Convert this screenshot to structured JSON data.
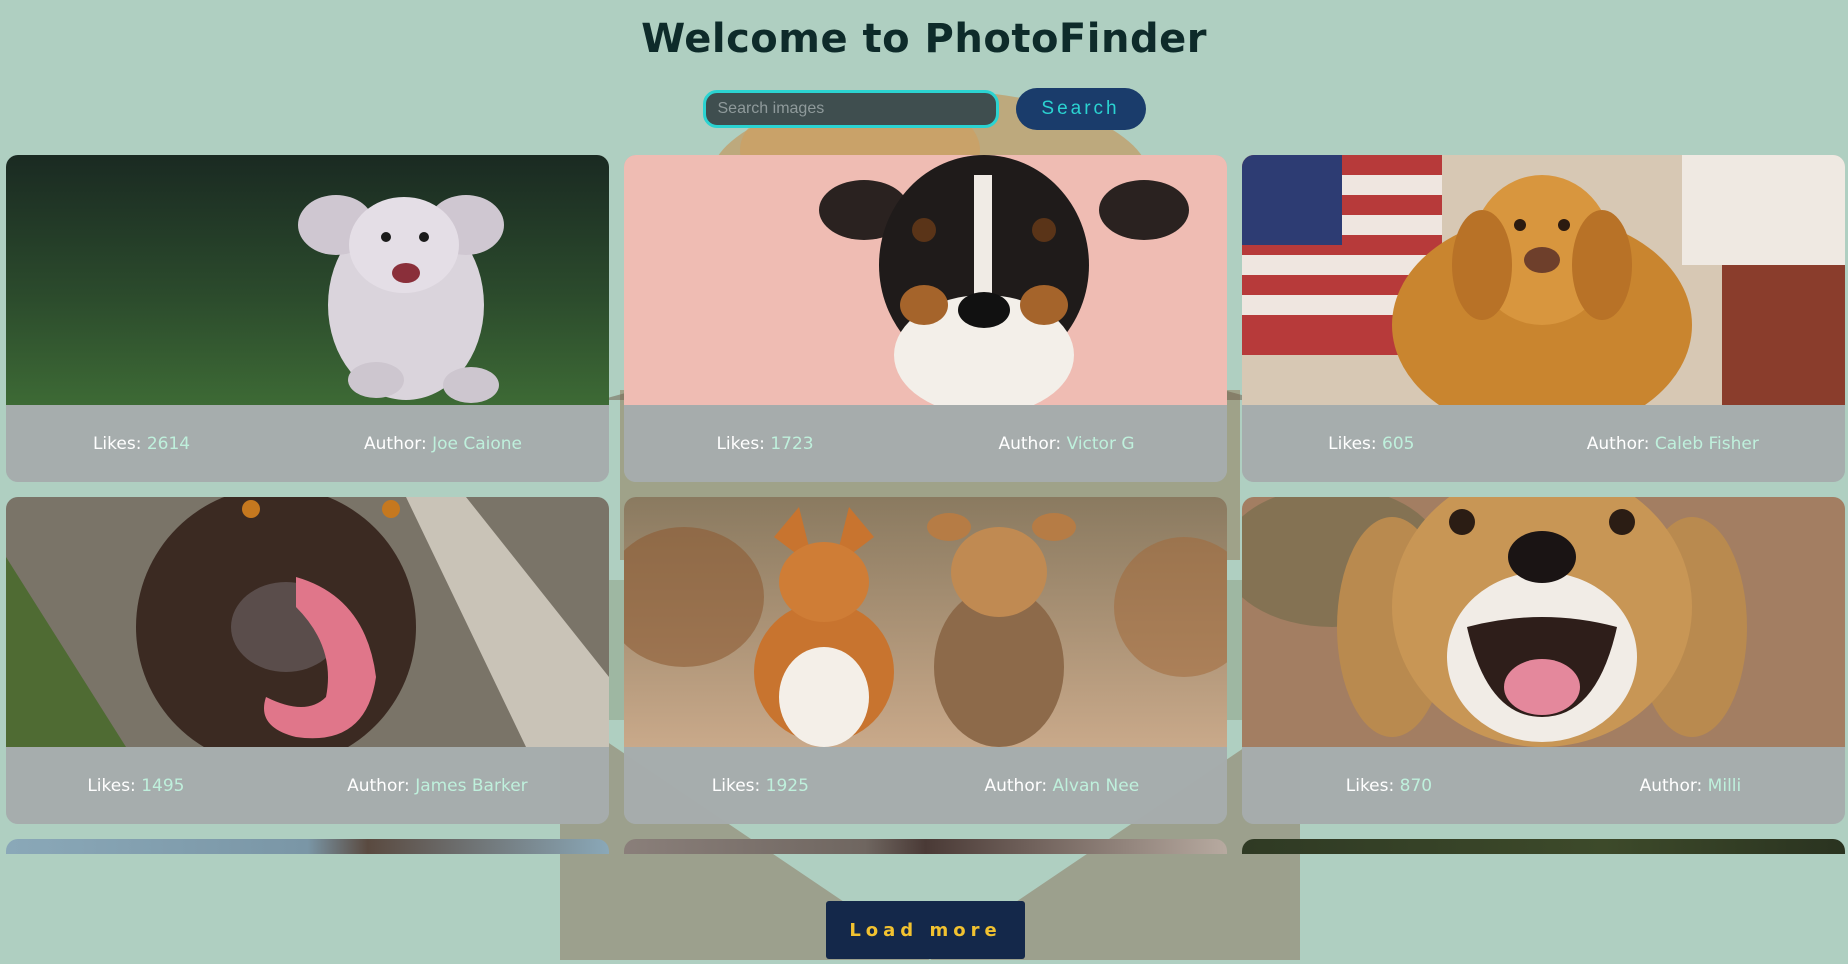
{
  "header": {
    "title": "Welcome to PhotoFinder"
  },
  "search": {
    "placeholder": "Search images",
    "value": "",
    "button_label": "Search"
  },
  "labels": {
    "likes": "Likes:",
    "author": "Author:"
  },
  "photos": [
    {
      "likes": "2614",
      "author": "Joe Caione",
      "subject": "white-poodle-running"
    },
    {
      "likes": "1723",
      "author": "Victor G",
      "subject": "terrier-pink-backdrop"
    },
    {
      "likes": "605",
      "author": "Caleb Fisher",
      "subject": "golden-retriever-flag"
    },
    {
      "likes": "1495",
      "author": "James Barker",
      "subject": "brown-dog-tongue"
    },
    {
      "likes": "1925",
      "author": "Alvan Nee",
      "subject": "corgi-and-yorkie"
    },
    {
      "likes": "870",
      "author": "Milli",
      "subject": "beagle-smiling"
    }
  ],
  "load_more": {
    "label": "Load more"
  },
  "colors": {
    "background": "#afcfc1",
    "title": "#0e2b2a",
    "accent": "#2bd3d1",
    "search_button": "#1a3c6b",
    "load_more_button": "#14284a",
    "load_more_text": "#f2c230",
    "author_value": "#bff0dc"
  }
}
